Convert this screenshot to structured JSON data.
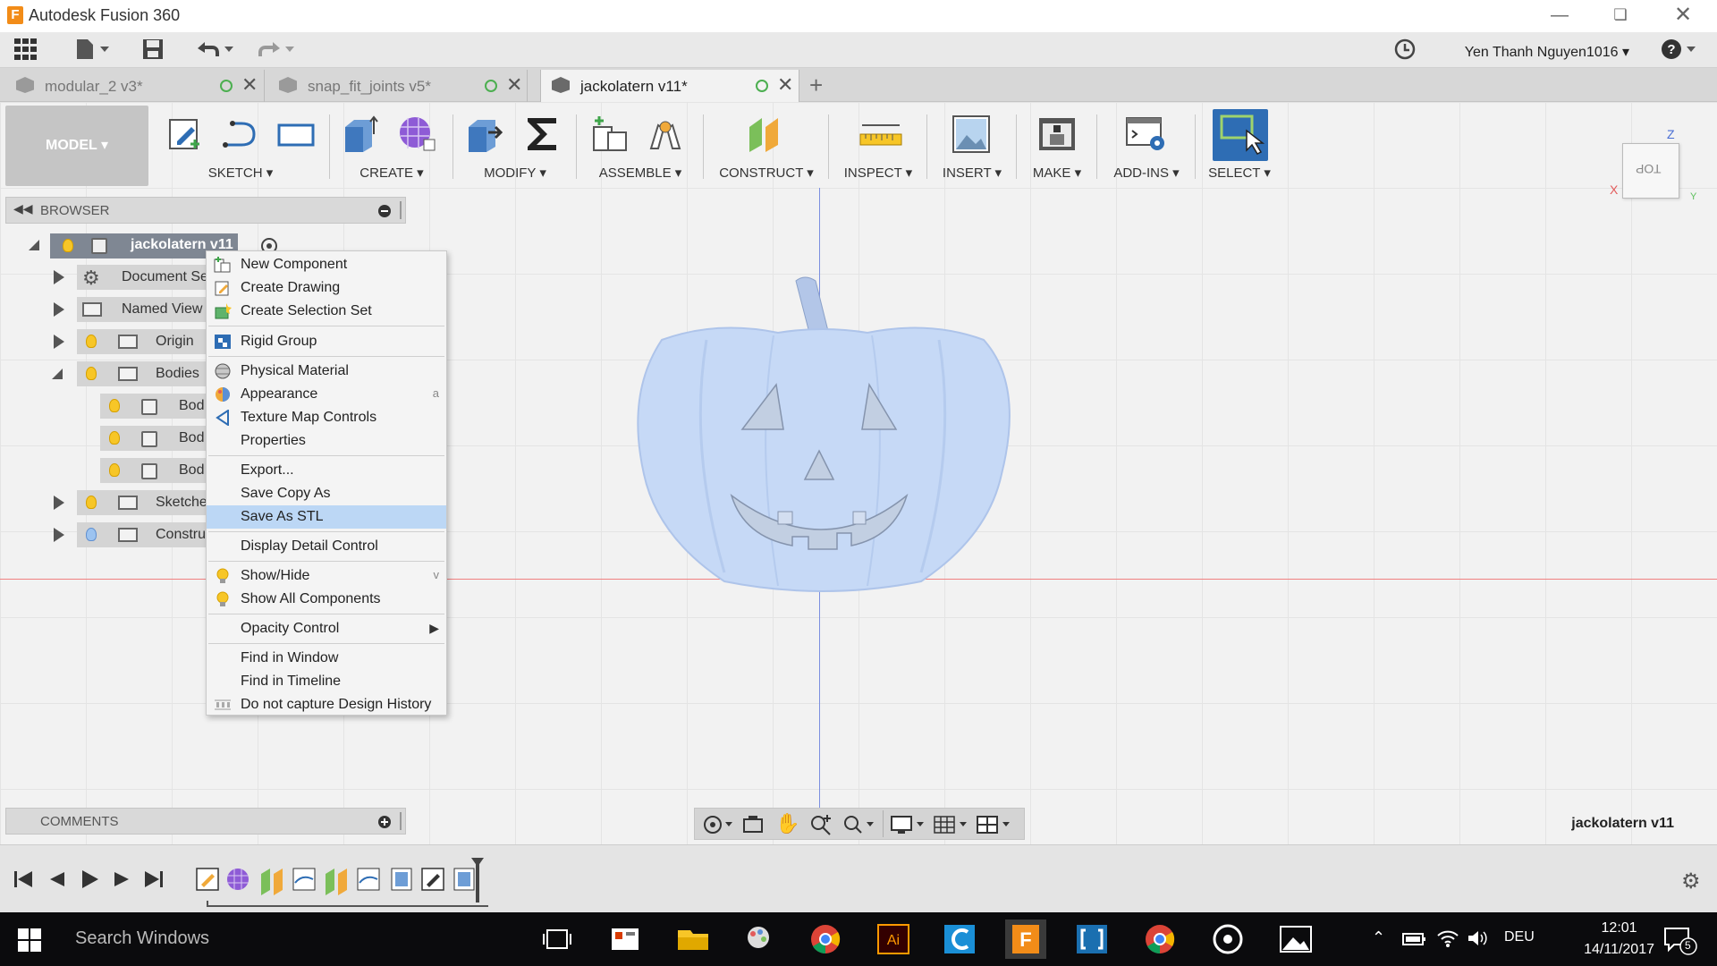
{
  "window": {
    "title": "Autodesk Fusion 360",
    "logo_letter": "F"
  },
  "qat": {
    "user": "Yen Thanh Nguyen1016",
    "help": "?"
  },
  "tabs": [
    {
      "label": "modular_2 v3*",
      "active": false
    },
    {
      "label": "snap_fit_joints v5*",
      "active": false
    },
    {
      "label": "jackolatern v11*",
      "active": true
    }
  ],
  "toolbar": {
    "workspace": "MODEL",
    "groups": [
      "SKETCH",
      "CREATE",
      "MODIFY",
      "ASSEMBLE",
      "CONSTRUCT",
      "INSPECT",
      "INSERT",
      "MAKE",
      "ADD-INS",
      "SELECT"
    ]
  },
  "browser": {
    "title": "BROWSER",
    "root": "jackolatern v11",
    "items": [
      {
        "label": "Document Se"
      },
      {
        "label": "Named View"
      },
      {
        "label": "Origin"
      },
      {
        "label": "Bodies"
      },
      {
        "label": "Bod"
      },
      {
        "label": "Bod"
      },
      {
        "label": "Bod"
      },
      {
        "label": "Sketche"
      },
      {
        "label": "Constru"
      }
    ]
  },
  "context_menu": {
    "items": [
      "New Component",
      "Create Drawing",
      "Create Selection Set",
      "Rigid Group",
      "Physical Material",
      "Appearance",
      "Texture Map Controls",
      "Properties",
      "Export...",
      "Save Copy As",
      "Save As STL",
      "Display Detail Control",
      "Show/Hide",
      "Show All Components",
      "Opacity Control",
      "Find in Window",
      "Find in Timeline",
      "Do not capture Design History"
    ],
    "shortcut_appearance": "a",
    "shortcut_showhide": "v",
    "highlighted": "Save As STL"
  },
  "viewcube": {
    "face": "TOP",
    "axis_z": "Z",
    "axis_x": "X",
    "axis_y": "Y"
  },
  "comments": {
    "title": "COMMENTS"
  },
  "document_name": "jackolatern v11",
  "taskbar": {
    "search_placeholder": "Search Windows",
    "language": "DEU",
    "time": "12:01",
    "date": "14/11/2017",
    "notifications": "5"
  },
  "colors": {
    "accent_select": "#2e6db4",
    "menu_highlight": "#bcd7f5",
    "pumpkin_fill": "#c6d9f6",
    "taskbar": "#0b0b0d"
  }
}
